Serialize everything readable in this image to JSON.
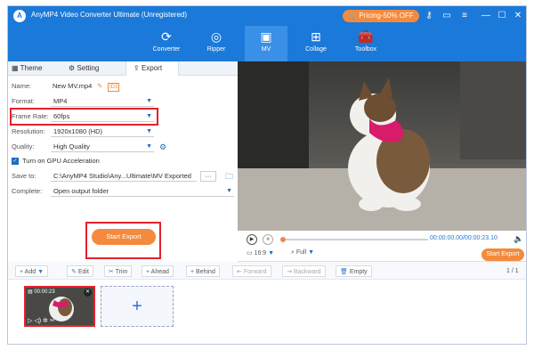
{
  "window": {
    "title": "AnyMP4 Video Converter Ultimate (Unregistered)",
    "pricing": "Pricing-50% OFF"
  },
  "nav": {
    "items": [
      {
        "label": "Converter"
      },
      {
        "label": "Ripper"
      },
      {
        "label": "MV"
      },
      {
        "label": "Collage"
      },
      {
        "label": "Toolbox"
      }
    ]
  },
  "tabs": {
    "theme": "Theme",
    "setting": "Setting",
    "export": "Export"
  },
  "export": {
    "name_label": "Name:",
    "name_value": "New MV.mp4",
    "format_label": "Format:",
    "format_value": "MP4",
    "framerate_label": "Frame Rate:",
    "framerate_value": "60fps",
    "resolution_label": "Resolution:",
    "resolution_value": "1920x1080 (HD)",
    "quality_label": "Quality:",
    "quality_value": "High Quality",
    "gpu_label": "Turn on GPU Acceleration",
    "saveto_label": "Save to:",
    "saveto_value": "C:\\AnyMP4 Studio\\Any...Ultimate\\MV Exported",
    "complete_label": "Complete:",
    "complete_value": "Open output folder",
    "start_export": "Start Export"
  },
  "player": {
    "time": "00:00:00.00/00:00:23.10",
    "ratio": "16:9",
    "zoom": "Full",
    "start_export": "Start Export"
  },
  "toolbar": {
    "add": "Add",
    "edit": "Edit",
    "trim": "Trim",
    "ahead": "Ahead",
    "behind": "Behind",
    "forward": "Forward",
    "backward": "Backward",
    "empty": "Empty",
    "page": "1 / 1"
  },
  "clip": {
    "duration": "00:00:23"
  }
}
